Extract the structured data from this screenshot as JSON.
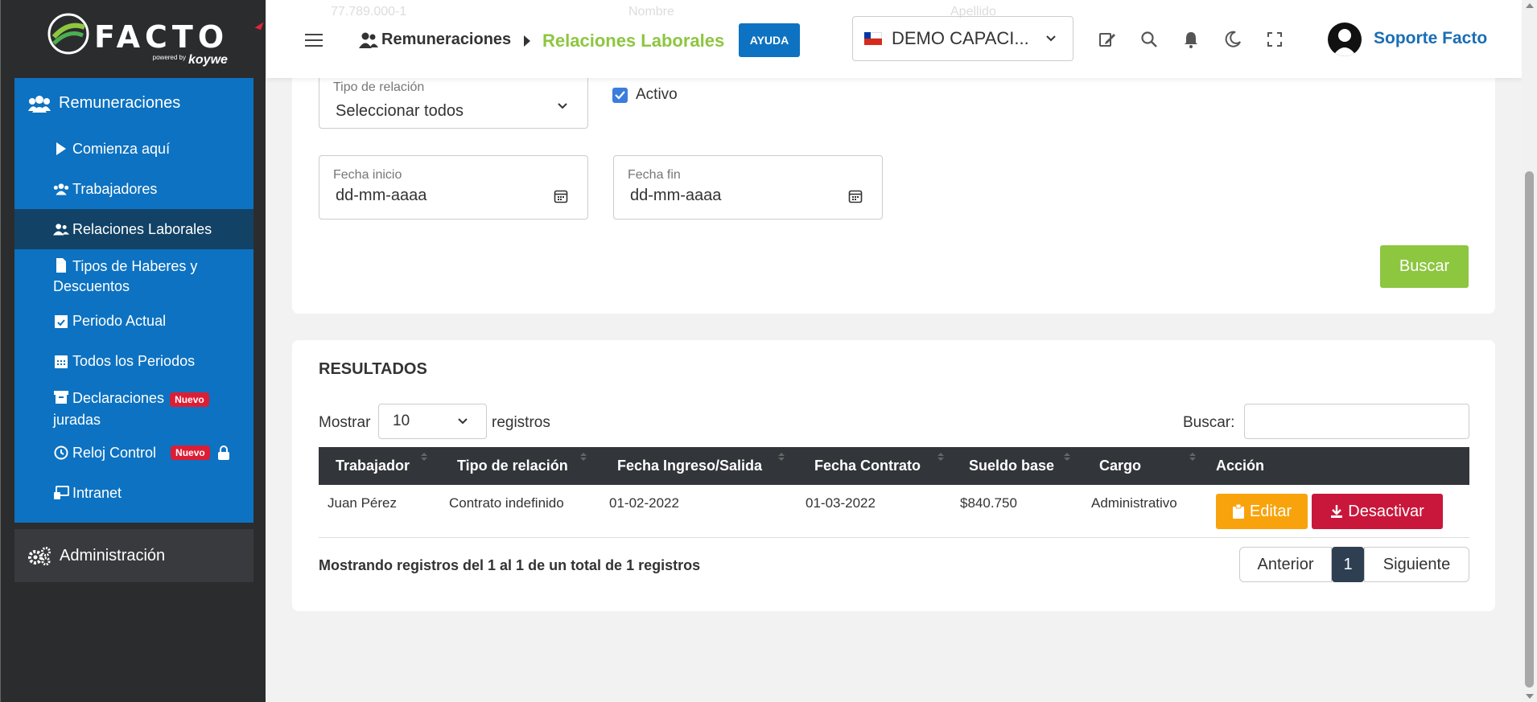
{
  "brand": {
    "logo_text": "FACTO",
    "powered_by": "powered by",
    "partner": "koywe",
    "colors": {
      "primary": "#0d72c1",
      "accent": "#8dc63f",
      "danger": "#c8173b",
      "warning": "#f8a30c",
      "sidebar_bg": "#2b2c2e"
    }
  },
  "sidebar": {
    "section": {
      "label": "Remuneraciones",
      "icon": "users-icon"
    },
    "items": [
      {
        "label": "Comienza aquí",
        "icon": "play-icon"
      },
      {
        "label": "Trabajadores",
        "icon": "users-icon"
      },
      {
        "label": "Relaciones Laborales",
        "icon": "user-group-icon",
        "active": true
      },
      {
        "label": "Tipos de Haberes y",
        "label2": "Descuentos",
        "icon": "file-icon"
      },
      {
        "label": "Periodo Actual",
        "icon": "calendar-check-icon"
      },
      {
        "label": "Todos los Periodos",
        "icon": "calendar-icon"
      },
      {
        "label": "Declaraciones",
        "label2": "juradas",
        "icon": "archive-icon",
        "badge": "Nuevo"
      },
      {
        "label": "Reloj Control",
        "icon": "clock-icon",
        "badge": "Nuevo",
        "locked": true
      },
      {
        "label": "Intranet",
        "icon": "monitor-icon"
      }
    ],
    "admin": {
      "label": "Administración",
      "icon": "cogs-icon"
    }
  },
  "header": {
    "ghost_left": "77.789.000-1",
    "ghost_mid": "Nombre",
    "ghost_right": "Apellido",
    "breadcrumb": [
      "Remuneraciones",
      "Relaciones Laborales"
    ],
    "help_label": "AYUDA",
    "company": "DEMO CAPACI...",
    "user_name": "Soporte Facto",
    "icons": [
      "edit-icon",
      "search-icon",
      "bell-icon",
      "moon-icon",
      "fullscreen-icon"
    ]
  },
  "filters": {
    "relation_type": {
      "label": "Tipo de relación",
      "value": "Seleccionar todos"
    },
    "active": {
      "label": "Activo",
      "checked": true
    },
    "start_date": {
      "label": "Fecha inicio",
      "value": "dd-mm-aaaa"
    },
    "end_date": {
      "label": "Fecha fin",
      "value": "dd-mm-aaaa"
    },
    "search_button": "Buscar"
  },
  "results": {
    "title": "RESULTADOS",
    "show_label": "Mostrar",
    "page_size": "10",
    "records_label": "registros",
    "search_label": "Buscar:",
    "columns": [
      "Trabajador",
      "Tipo de relación",
      "Fecha Ingreso/Salida",
      "Fecha Contrato",
      "Sueldo base",
      "Cargo",
      "Acción"
    ],
    "rows": [
      {
        "worker": "Juan Pérez",
        "relation": "Contrato indefinido",
        "entry_date": "01-02-2022",
        "contract_date": "01-03-2022",
        "salary": "$840.750",
        "position": "Administrativo",
        "edit_label": "Editar",
        "deactivate_label": "Desactivar"
      }
    ],
    "info": "Mostrando registros del 1 al 1 de un total de 1 registros",
    "pagination": {
      "prev": "Anterior",
      "current": "1",
      "next": "Siguiente"
    }
  }
}
